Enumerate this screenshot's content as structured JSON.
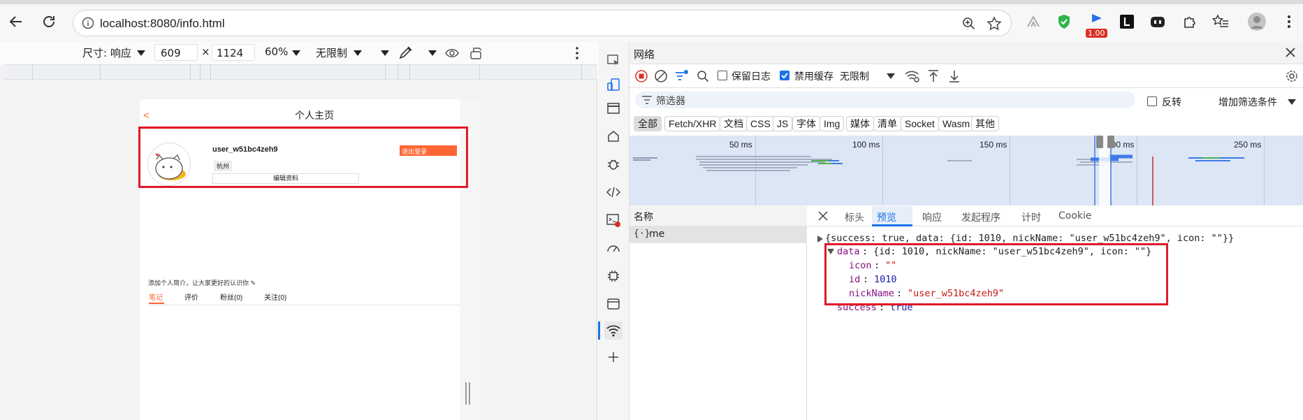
{
  "browser": {
    "url": "localhost:8080/info.html",
    "badge": "1.00"
  },
  "device_toolbar": {
    "dimensions_label": "尺寸: 响应",
    "width": "609",
    "times": "×",
    "height": "1124",
    "zoom": "60%",
    "throttle": "无限制"
  },
  "page": {
    "title": "个人主页",
    "back": "<",
    "username": "user_w51bc4zeh9",
    "logout": "退出登录",
    "city": "杭州",
    "edit_profile": "编辑资料",
    "intro_placeholder": "添加个人简介，让大家更好的认识你 ✎",
    "tabs": [
      "笔记",
      "评价",
      "粉丝(0)",
      "关注(0)"
    ]
  },
  "devtools": {
    "panel_title": "网络",
    "preserve_log": "保留日志",
    "disable_cache": "禁用缓存",
    "throttle": "无限制",
    "filter_placeholder": "筛选器",
    "invert": "反转",
    "more_filters": "增加筛选条件",
    "filter_types": [
      "全部",
      "Fetch/XHR",
      "文档",
      "CSS",
      "JS",
      "字体",
      "Img",
      "媒体",
      "清单",
      "Socket",
      "Wasm",
      "其他"
    ],
    "timeline_ticks": [
      "50 ms",
      "100 ms",
      "150 ms",
      "200 ms",
      "250 ms"
    ],
    "name_header": "名称",
    "request_name": "me",
    "detail_tabs": [
      "标头",
      "预览",
      "响应",
      "发起程序",
      "计时",
      "Cookie"
    ],
    "active_detail_tab": "预览",
    "preview": {
      "root_line": "{success: true, data: {id: 1010, nickName: \"user_w51bc4zeh9\", icon: \"\"}}",
      "data_key": "data",
      "data_summary": "{id: 1010, nickName: \"user_w51bc4zeh9\", icon: \"\"}",
      "icon_key": "icon",
      "icon_val": "\"\"",
      "id_key": "id",
      "id_val": "1010",
      "nick_key": "nickName",
      "nick_val": "\"user_w51bc4zeh9\"",
      "success_key": "success",
      "success_val": "true"
    }
  },
  "colors": {
    "accent_orange": "#ff6633",
    "highlight_red": "#e0192b",
    "devtools_blue": "#1a73e8"
  }
}
